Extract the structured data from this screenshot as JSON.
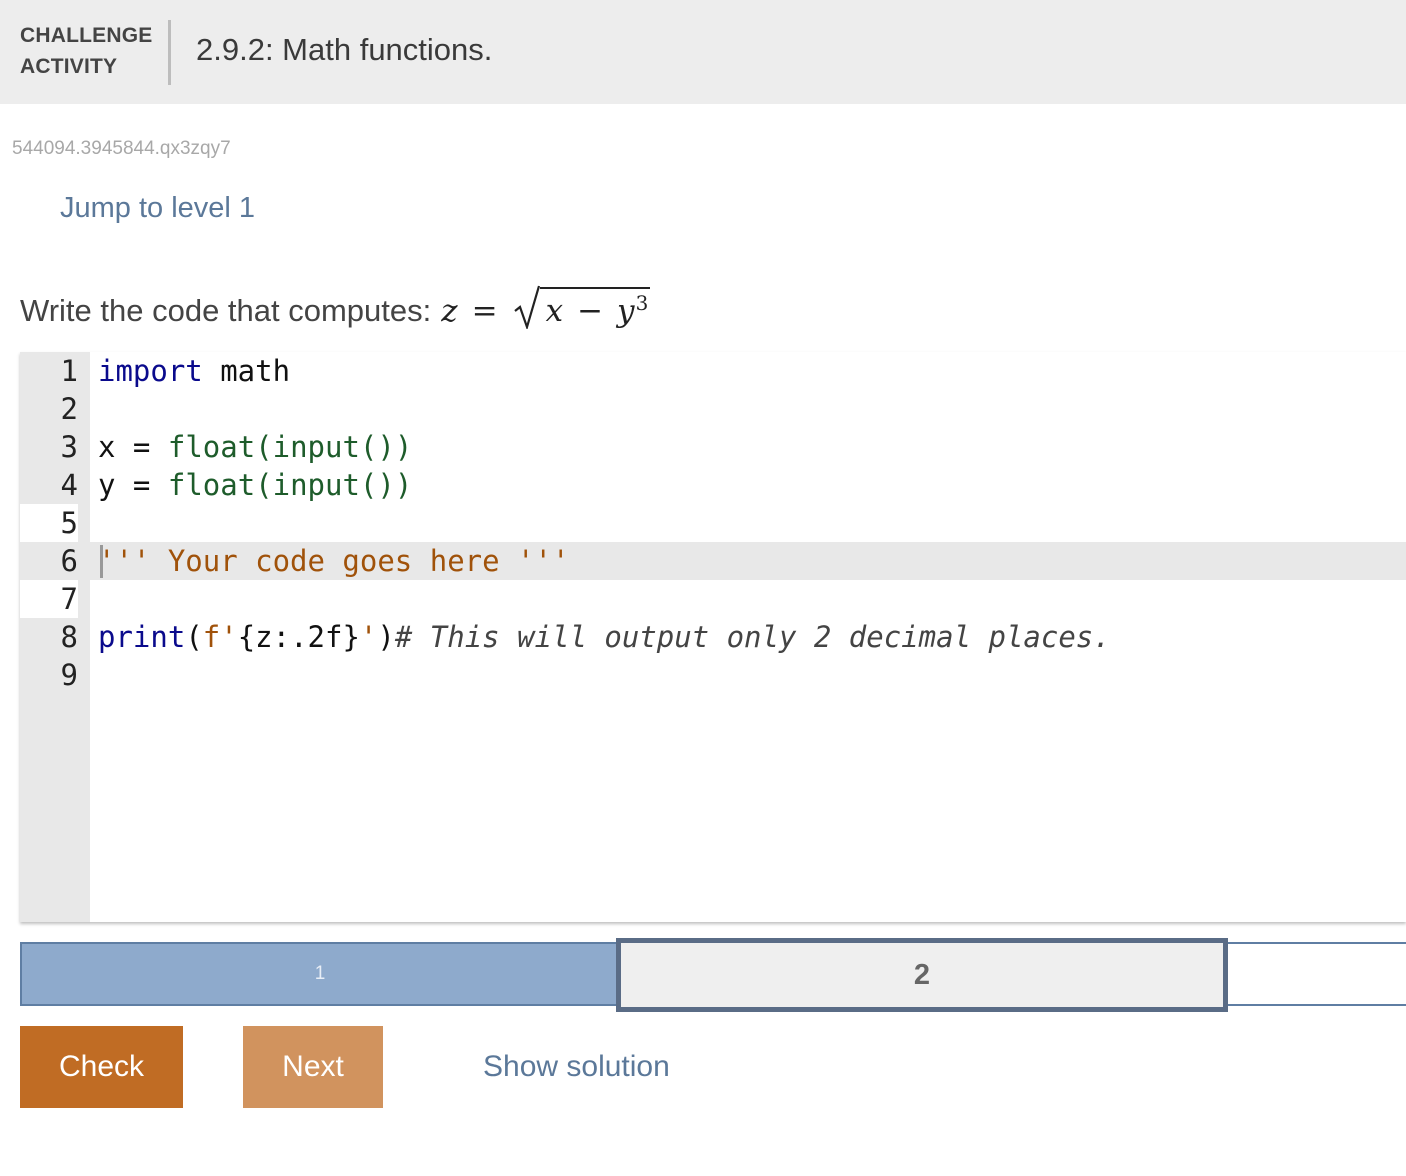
{
  "header": {
    "label_line1": "CHALLENGE",
    "label_line2": "ACTIVITY",
    "title": "2.9.2: Math functions."
  },
  "activity_id": "544094.3945844.qx3zqy7",
  "jump_link": "Jump to level 1",
  "prompt": {
    "text": "Write the code that computes:",
    "math_lhs": "z",
    "math_eq": "=",
    "math_x": "x",
    "math_minus": "−",
    "math_y": "y",
    "math_exp": "3"
  },
  "editor": {
    "lines": [
      {
        "num": "1",
        "kw": "import",
        "rest": " math"
      },
      {
        "num": "2"
      },
      {
        "num": "3",
        "var": "x",
        "eq": " = ",
        "fn": "float(input())"
      },
      {
        "num": "4",
        "var": "y",
        "eq": " = ",
        "fn": "float(input())"
      },
      {
        "num": "5"
      },
      {
        "num": "6",
        "str": "''' Your code goes here '''"
      },
      {
        "num": "7"
      },
      {
        "num": "8",
        "kw": "print",
        "punct1": "(",
        "fstr_prefix": "f'",
        "fstr_body": "{z:.2f}",
        "fstr_end": "'",
        "punct2": ")",
        "comment": "# This will output only 2 decimal places."
      },
      {
        "num": "9"
      }
    ]
  },
  "progress": {
    "level1": "1",
    "level2": "2"
  },
  "buttons": {
    "check": "Check",
    "next": "Next",
    "show_solution": "Show solution"
  },
  "colors": {
    "check": "#c06c24",
    "next": "#d1935e",
    "link": "#5b7899",
    "progress_done": "#8eaacc",
    "progress_active_border": "#5a6c86"
  }
}
